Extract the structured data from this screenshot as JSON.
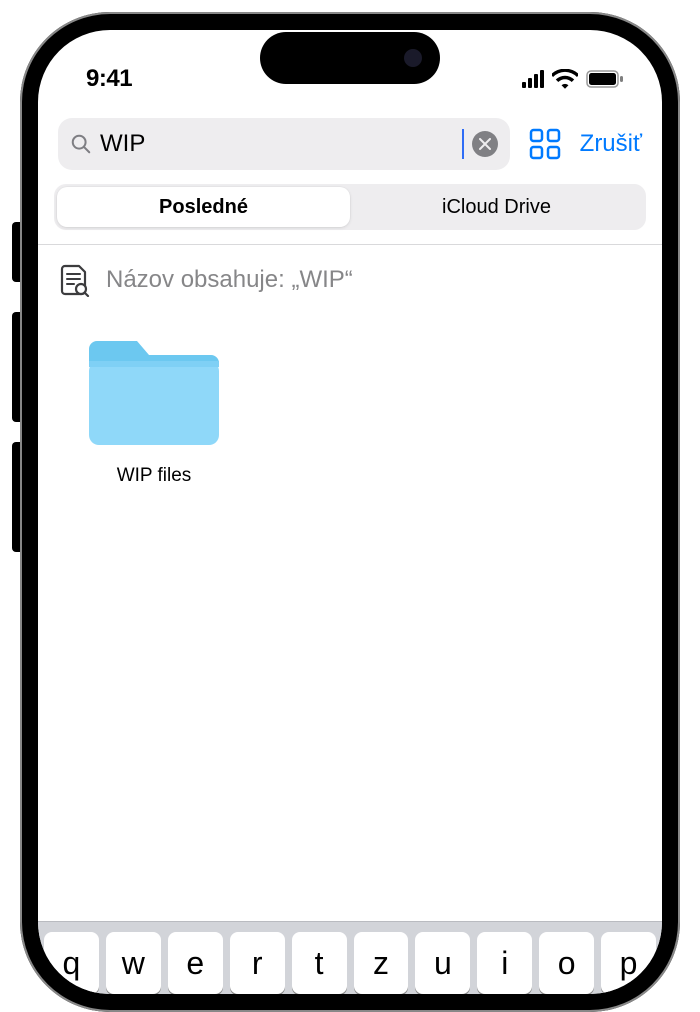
{
  "status": {
    "time": "9:41"
  },
  "search": {
    "value": "WIP",
    "cancel_label": "Zrušiť"
  },
  "segments": {
    "recent": "Posledné",
    "icloud": "iCloud Drive"
  },
  "suggestion": {
    "text": "Názov obsahuje: „WIP“"
  },
  "results": [
    {
      "name": "WIP files"
    }
  ],
  "keyboard": {
    "row1": [
      "q",
      "w",
      "e",
      "r",
      "t",
      "z",
      "u",
      "i",
      "o",
      "p"
    ]
  },
  "colors": {
    "accent": "#007aff",
    "folder": "#7fd3f7"
  }
}
